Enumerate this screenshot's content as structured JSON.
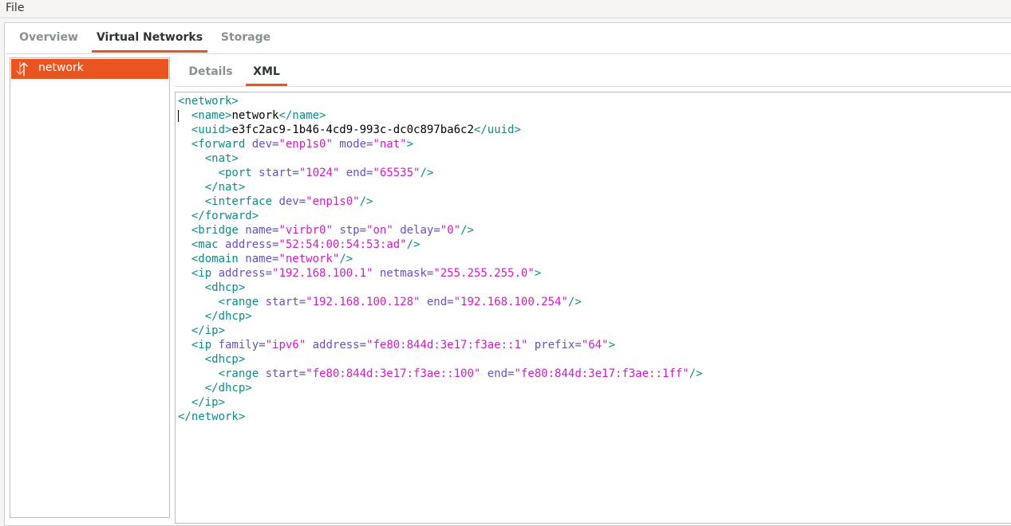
{
  "menubar": {
    "file": "File"
  },
  "main_tabs": [
    {
      "label": "Overview",
      "active": false
    },
    {
      "label": "Virtual Networks",
      "active": true
    },
    {
      "label": "Storage",
      "active": false
    }
  ],
  "networks": [
    {
      "name": "network",
      "icon": "network-transfer-icon",
      "selected": true
    }
  ],
  "detail_tabs": [
    {
      "label": "Details",
      "active": false
    },
    {
      "label": "XML",
      "active": true
    }
  ],
  "xml_lines": [
    [
      [
        "t",
        "<network>"
      ]
    ],
    [
      [
        "t",
        "  <name>"
      ],
      [
        "x",
        "network"
      ],
      [
        "t",
        "</name>"
      ]
    ],
    [
      [
        "t",
        "  <uuid>"
      ],
      [
        "x",
        "e3fc2ac9-1b46-4cd9-993c-dc0c897ba6c2"
      ],
      [
        "t",
        "</uuid>"
      ]
    ],
    [
      [
        "t",
        "  <forward "
      ],
      [
        "a",
        "dev="
      ],
      [
        "v",
        "\"enp1s0\""
      ],
      [
        "a",
        " mode="
      ],
      [
        "v",
        "\"nat\""
      ],
      [
        "t",
        ">"
      ]
    ],
    [
      [
        "t",
        "    <nat>"
      ]
    ],
    [
      [
        "t",
        "      <port "
      ],
      [
        "a",
        "start="
      ],
      [
        "v",
        "\"1024\""
      ],
      [
        "a",
        " end="
      ],
      [
        "v",
        "\"65535\""
      ],
      [
        "t",
        "/>"
      ]
    ],
    [
      [
        "t",
        "    </nat>"
      ]
    ],
    [
      [
        "t",
        "    <interface "
      ],
      [
        "a",
        "dev="
      ],
      [
        "v",
        "\"enp1s0\""
      ],
      [
        "t",
        "/>"
      ]
    ],
    [
      [
        "t",
        "  </forward>"
      ]
    ],
    [
      [
        "t",
        "  <bridge "
      ],
      [
        "a",
        "name="
      ],
      [
        "v",
        "\"virbr0\""
      ],
      [
        "a",
        " stp="
      ],
      [
        "v",
        "\"on\""
      ],
      [
        "a",
        " delay="
      ],
      [
        "v",
        "\"0\""
      ],
      [
        "t",
        "/>"
      ]
    ],
    [
      [
        "t",
        "  <mac "
      ],
      [
        "a",
        "address="
      ],
      [
        "v",
        "\"52:54:00:54:53:ad\""
      ],
      [
        "t",
        "/>"
      ]
    ],
    [
      [
        "t",
        "  <domain "
      ],
      [
        "a",
        "name="
      ],
      [
        "v",
        "\"network\""
      ],
      [
        "t",
        "/>"
      ]
    ],
    [
      [
        "t",
        "  <ip "
      ],
      [
        "a",
        "address="
      ],
      [
        "v",
        "\"192.168.100.1\""
      ],
      [
        "a",
        " netmask="
      ],
      [
        "v",
        "\"255.255.255.0\""
      ],
      [
        "t",
        ">"
      ]
    ],
    [
      [
        "t",
        "    <dhcp>"
      ]
    ],
    [
      [
        "t",
        "      <range "
      ],
      [
        "a",
        "start="
      ],
      [
        "v",
        "\"192.168.100.128\""
      ],
      [
        "a",
        " end="
      ],
      [
        "v",
        "\"192.168.100.254\""
      ],
      [
        "t",
        "/>"
      ]
    ],
    [
      [
        "t",
        "    </dhcp>"
      ]
    ],
    [
      [
        "t",
        "  </ip>"
      ]
    ],
    [
      [
        "t",
        "  <ip "
      ],
      [
        "a",
        "family="
      ],
      [
        "v",
        "\"ipv6\""
      ],
      [
        "a",
        " address="
      ],
      [
        "v",
        "\"fe80:844d:3e17:f3ae::1\""
      ],
      [
        "a",
        " prefix="
      ],
      [
        "v",
        "\"64\""
      ],
      [
        "t",
        ">"
      ]
    ],
    [
      [
        "t",
        "    <dhcp>"
      ]
    ],
    [
      [
        "t",
        "      <range "
      ],
      [
        "a",
        "start="
      ],
      [
        "v",
        "\"fe80:844d:3e17:f3ae::100\""
      ],
      [
        "a",
        " end="
      ],
      [
        "v",
        "\"fe80:844d:3e17:f3ae::1ff\""
      ],
      [
        "t",
        "/>"
      ]
    ],
    [
      [
        "t",
        "    </dhcp>"
      ]
    ],
    [
      [
        "t",
        "  </ip>"
      ]
    ],
    [
      [
        "t",
        "</network>"
      ]
    ]
  ],
  "colors": {
    "accent": "#e95420",
    "xml_tag": "#0e8a8a",
    "xml_attr": "#6a4fc0",
    "xml_value": "#d11ac8",
    "xml_text": "#000000"
  }
}
